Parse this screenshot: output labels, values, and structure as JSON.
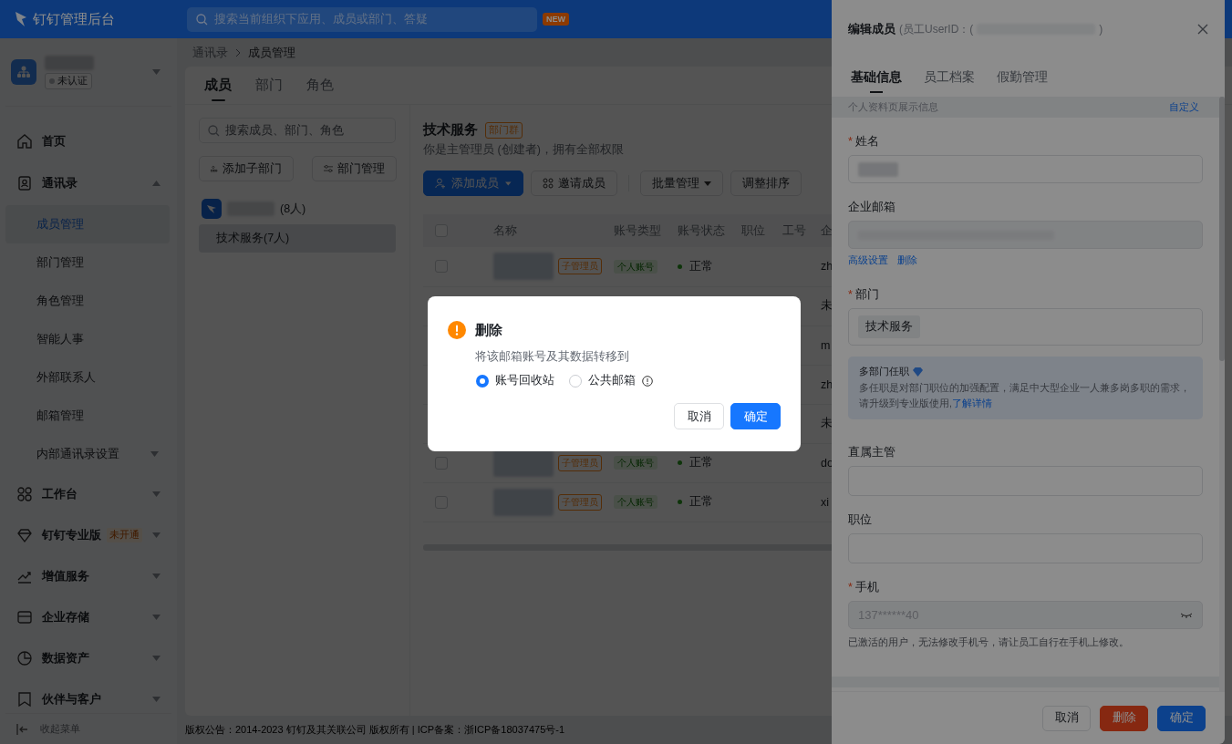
{
  "header": {
    "title": "钉钉管理后台",
    "search_placeholder": "搜索当前组织下应用、成员或部门、答疑",
    "badge": "NEW"
  },
  "org": {
    "status": "未认证"
  },
  "sidebar": {
    "items": [
      {
        "label": "首页"
      },
      {
        "label": "通讯录",
        "expanded": true,
        "children": [
          {
            "label": "成员管理",
            "selected": true
          },
          {
            "label": "部门管理",
            "selected": false
          },
          {
            "label": "角色管理",
            "selected": false
          },
          {
            "label": "智能人事",
            "selected": false
          },
          {
            "label": "外部联系人",
            "selected": false
          },
          {
            "label": "邮箱管理",
            "selected": false
          },
          {
            "label": "内部通讯录设置",
            "selected": false,
            "expanded": false
          }
        ]
      },
      {
        "label": "工作台",
        "expanded": false
      },
      {
        "label": "钉钉专业版",
        "badge": "未开通",
        "expanded": false
      },
      {
        "label": "增值服务",
        "expanded": false
      },
      {
        "label": "企业存储",
        "expanded": false
      },
      {
        "label": "数据资产",
        "expanded": false
      },
      {
        "label": "伙伴与客户",
        "expanded": false
      }
    ],
    "collapse": "收起菜单"
  },
  "breadcrumb": [
    "通讯录",
    "成员管理"
  ],
  "tabs": [
    {
      "label": "成员",
      "selected": true
    },
    {
      "label": "部门",
      "selected": false
    },
    {
      "label": "角色",
      "selected": false
    }
  ],
  "dept_panel": {
    "search_placeholder": "搜索成员、部门、角色",
    "buttons": [
      "添加子部门",
      "部门管理"
    ],
    "root": "(8人)",
    "departments": [
      {
        "label": "技术服务(7人)",
        "selected": true
      }
    ]
  },
  "dept": {
    "title": "技术服务",
    "tag": "部门群",
    "subtitle": "你是主管理员 (创建者)，拥有全部权限",
    "actions": [
      {
        "label": "添加成员",
        "kind": "primary"
      },
      {
        "label": "邀请成员",
        "kind": "invite"
      },
      {
        "label": "批量管理",
        "kind": "dropdown"
      },
      {
        "label": "调整排序",
        "kind": "plain"
      }
    ]
  },
  "table": {
    "header_checked": false,
    "columns": [
      "名称",
      "账号类型",
      "账号状态",
      "职位",
      "工号",
      "企"
    ],
    "rows": [
      {
        "checked": false,
        "role_tag": "子管理员",
        "account_type": "个人账号",
        "status": "正常",
        "column_7": "zh"
      },
      {
        "column_7": "未"
      },
      {
        "column_7": "m"
      },
      {
        "column_7": "zh"
      },
      {
        "column_7": "未"
      },
      {
        "checked": false,
        "role_tag": "子管理员",
        "account_type": "个人账号",
        "status": "正常",
        "column_7": "do"
      },
      {
        "checked": false,
        "role_tag": "子管理员",
        "account_type": "个人账号",
        "status": "正常",
        "column_7": "xi"
      }
    ]
  },
  "footer": "版权公告：2014-2023 钉钉及其关联公司 版权所有 | ICP备案：浙ICP备18037475号-1",
  "drawer": {
    "title": "编辑成员",
    "id_prefix": "(员工UserID：(",
    "id_suffix": ")",
    "tabs": [
      {
        "label": "基础信息",
        "selected": true
      },
      {
        "label": "员工档案",
        "selected": false
      },
      {
        "label": "假勤管理",
        "selected": false
      }
    ],
    "section": "个人资料页展示信息",
    "section_link": "自定义",
    "fields": [
      {
        "kind": "redacted",
        "label": "姓名",
        "required_mark": "*"
      },
      {
        "kind": "redacted-disabled",
        "label": "企业邮箱",
        "links": [
          "高级设置",
          "删除"
        ]
      },
      {
        "kind": "tags",
        "label": "部门",
        "required_mark": "*",
        "tags": [
          "技术服务"
        ]
      },
      {
        "kind": "notice",
        "title": "多部门任职",
        "text": "多任职是对部门职位的加强配置，满足中大型企业一人兼多岗多职的需求，请升级到专业版使用,",
        "link": "了解详情"
      },
      {
        "kind": "text",
        "label": "直属主管"
      },
      {
        "kind": "text",
        "label": "职位"
      },
      {
        "kind": "phone",
        "label": "手机",
        "required_mark": "*",
        "value": "137******40",
        "help": "已激活的用户，无法修改手机号，请让员工自行在手机上修改。"
      }
    ],
    "buttons": [
      {
        "label": "取消",
        "kind": "default"
      },
      {
        "label": "删除",
        "kind": "danger"
      },
      {
        "label": "确定",
        "kind": "primary"
      }
    ]
  },
  "modal": {
    "title": "删除",
    "message": "将该邮箱账号及其数据转移到",
    "options": [
      {
        "label": "账号回收站",
        "selected": true,
        "info": false
      },
      {
        "label": "公共邮箱",
        "selected": false,
        "info": true
      }
    ],
    "buttons": [
      {
        "label": "取消",
        "kind": "default"
      },
      {
        "label": "确定",
        "kind": "primary"
      }
    ]
  }
}
